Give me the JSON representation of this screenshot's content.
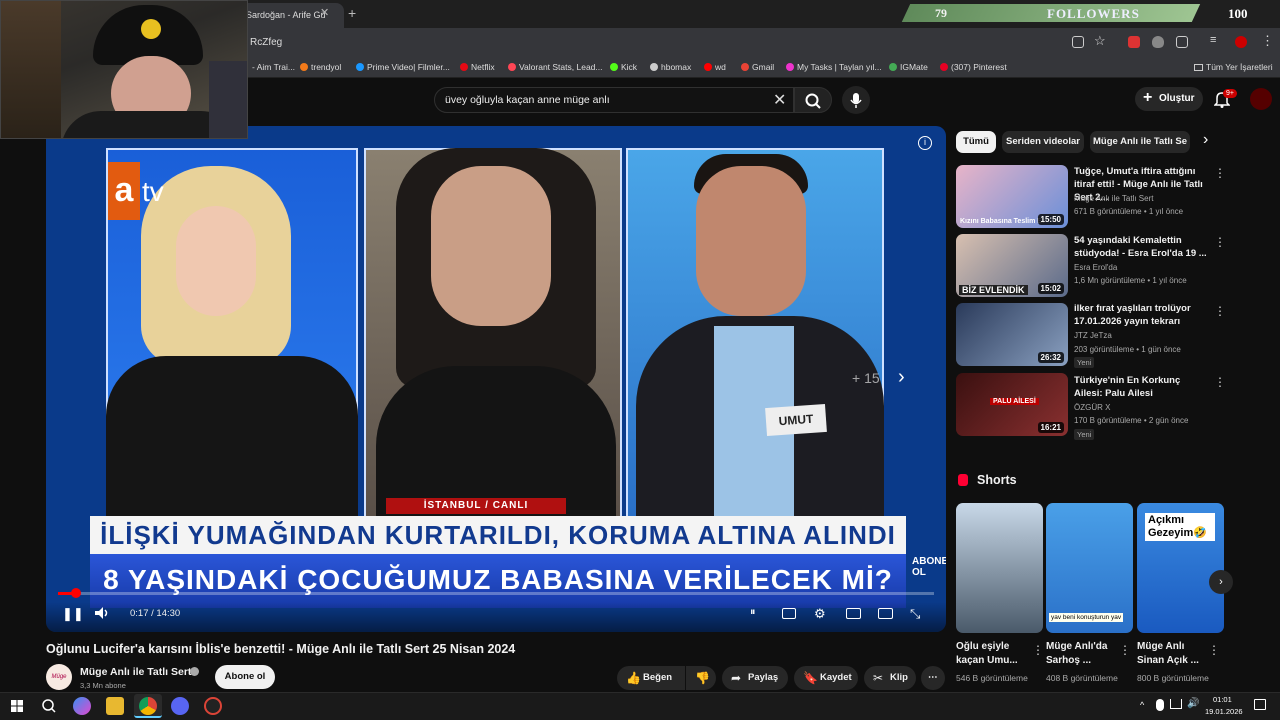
{
  "browser": {
    "tab_title": "Sardoğan - Arife Gü",
    "url_fragment": "RcZfeg",
    "bookmarks": [
      "- Aim Trai...",
      "trendyol",
      "Prime Video| Filmler...",
      "Netflix",
      "Valorant Stats, Lead...",
      "Kick",
      "hbomax",
      "wd",
      "Gmail",
      "My Tasks | Taylan yıl...",
      "IGMate",
      "(307) Pinterest"
    ],
    "all_bookmarks": "Tüm Yer İşaretleri"
  },
  "overlay": {
    "followers_current": "79",
    "followers_label": "FOLLOWERS",
    "followers_goal": "100"
  },
  "youtube": {
    "search_query": "üvey oğluyla kaçan anne müge anlı",
    "create_label": "Oluştur",
    "notif_count": "9+",
    "chips": [
      "Tümü",
      "Seriden videolar",
      "Müge Anlı ile Tatlı Se"
    ]
  },
  "player": {
    "channel_logo_a": "a",
    "channel_logo_tv": "tv",
    "location": "İSTANBUL / CANLI",
    "headline_line1": "İLİŞKİ YUMAĞINDAN KURTARILDI, KORUMA ALTINA ALINDI",
    "headline_line2": "8 YAŞINDAKİ ÇOCUĞUMUZ BABASINA VERİLECEK Mİ?",
    "name_tag": "UMUT",
    "watermark": "ABONE OL",
    "more_count": "+ 15",
    "time": "0:17 / 14:30",
    "progress": 0.02
  },
  "video": {
    "title": "Oğlunu Lucifer'a karısını İblis'e benzetti! - Müge Anlı ile Tatlı Sert 25 Nisan 2024",
    "channel_name": "Müge Anlı ile Tatlı Sert",
    "avatar_text": "Müge Anlı",
    "subscribers": "3,3 Mn abone",
    "subscribe_label": "Abone ol",
    "like_label": "Beğen",
    "share_label": "Paylaş",
    "save_label": "Kaydet",
    "clip_label": "Klip"
  },
  "recommendations": [
    {
      "title": "Tuğçe, Umut'a iftira attığını itiraf etti! - Müge Anlı ile Tatlı Sert 2...",
      "channel": "Müge Anlı ile Tatlı Sert",
      "meta": "671 B görüntüleme • 1 yıl önce",
      "duration": "15:50",
      "thumb_text": "Kızını Babasına Teslim Et",
      "badge": ""
    },
    {
      "title": "54 yaşındaki Kemalettin stüdyoda! - Esra Erol'da 19 ...",
      "channel": "Esra Erol'da",
      "meta": "1,6 Mn görüntüleme • 1 yıl önce",
      "duration": "15:02",
      "thumb_text": "BİZ EVLENDİK",
      "badge": ""
    },
    {
      "title": "ilker fırat yaşlıları trolüyor 17.01.2026 yayın tekrarı",
      "channel": "JTZ JeTza",
      "meta": "203 görüntüleme • 1 gün önce",
      "duration": "26:32",
      "thumb_text": "",
      "badge": "Yeni"
    },
    {
      "title": "Türkiye'nin En Korkunç Ailesi: Palu Ailesi",
      "channel": "ÖZGÜR X",
      "meta": "170 B görüntüleme • 2 gün önce",
      "duration": "16:21",
      "thumb_text": "PALU AİLESİ",
      "badge": "Yeni"
    }
  ],
  "shorts": {
    "label": "Shorts",
    "items": [
      {
        "title": "Oğlu eşiyle kaçan Umu...",
        "views": "546 B görüntüleme",
        "thumb_text": ""
      },
      {
        "title": "Müge Anlı'da Sarhoş ...",
        "views": "408 B görüntüleme",
        "thumb_text": "yav beni konuşturun yav"
      },
      {
        "title": "Müge Anlı Sinan Açık ...",
        "views": "800 B görüntüleme",
        "thumb_text": "Açıkmı Gezeyim🤣"
      }
    ]
  },
  "taskbar": {
    "time": "01:01",
    "date": "19.01.2026"
  }
}
